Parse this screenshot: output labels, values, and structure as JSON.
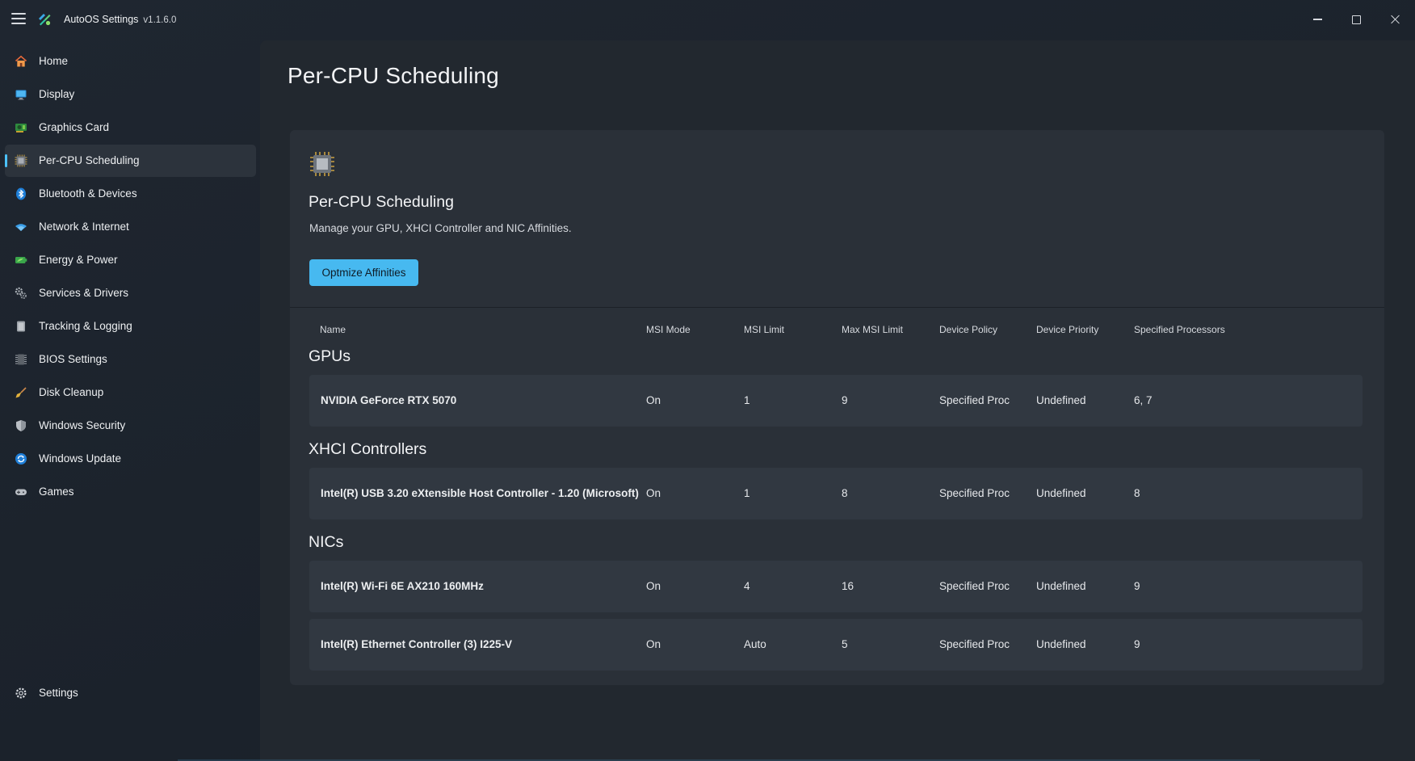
{
  "app": {
    "title": "AutoOS Settings",
    "version": "v1.1.6.0"
  },
  "sidebar": {
    "items": [
      {
        "label": "Home",
        "icon": "home-icon"
      },
      {
        "label": "Display",
        "icon": "monitor-icon"
      },
      {
        "label": "Graphics Card",
        "icon": "graphics-card-icon"
      },
      {
        "label": "Per-CPU Scheduling",
        "icon": "cpu-icon",
        "selected": true
      },
      {
        "label": "Bluetooth & Devices",
        "icon": "bluetooth-icon"
      },
      {
        "label": "Network & Internet",
        "icon": "wifi-icon"
      },
      {
        "label": "Energy & Power",
        "icon": "battery-icon"
      },
      {
        "label": "Services & Drivers",
        "icon": "gears-icon"
      },
      {
        "label": "Tracking & Logging",
        "icon": "clipboard-icon"
      },
      {
        "label": "BIOS Settings",
        "icon": "chip-icon"
      },
      {
        "label": "Disk Cleanup",
        "icon": "broom-icon"
      },
      {
        "label": "Windows Security",
        "icon": "shield-icon"
      },
      {
        "label": "Windows Update",
        "icon": "update-icon"
      },
      {
        "label": "Games",
        "icon": "gamepad-icon"
      }
    ],
    "footer": {
      "label": "Settings",
      "icon": "gear-icon"
    }
  },
  "page": {
    "title": "Per-CPU Scheduling"
  },
  "card": {
    "title": "Per-CPU Scheduling",
    "description": "Manage your GPU, XHCI Controller and NIC Affinities.",
    "button_label": "Optmize Affinities"
  },
  "table": {
    "columns": [
      "Name",
      "MSI Mode",
      "MSI Limit",
      "Max MSI Limit",
      "Device Policy",
      "Device Priority",
      "Specified Processors"
    ],
    "sections": [
      {
        "title": "GPUs",
        "rows": [
          [
            "NVIDIA GeForce RTX 5070",
            "On",
            "1",
            "9",
            "Specified Proc",
            "Undefined",
            "6, 7"
          ]
        ]
      },
      {
        "title": "XHCI Controllers",
        "rows": [
          [
            "Intel(R) USB 3.20 eXtensible Host Controller - 1.20 (Microsoft)",
            "On",
            "1",
            "8",
            "Specified Proc",
            "Undefined",
            "8"
          ]
        ]
      },
      {
        "title": "NICs",
        "rows": [
          [
            "Intel(R) Wi-Fi 6E AX210 160MHz",
            "On",
            "4",
            "16",
            "Specified Proc",
            "Undefined",
            "9"
          ],
          [
            "Intel(R) Ethernet Controller (3) I225-V",
            "On",
            "Auto",
            "5",
            "Specified Proc",
            "Undefined",
            "9"
          ]
        ]
      }
    ]
  },
  "colors": {
    "accent": "#4cc2ff",
    "button": "#47b9f0",
    "background": "#1e242c",
    "card": "#2a3038",
    "row": "#313841"
  }
}
